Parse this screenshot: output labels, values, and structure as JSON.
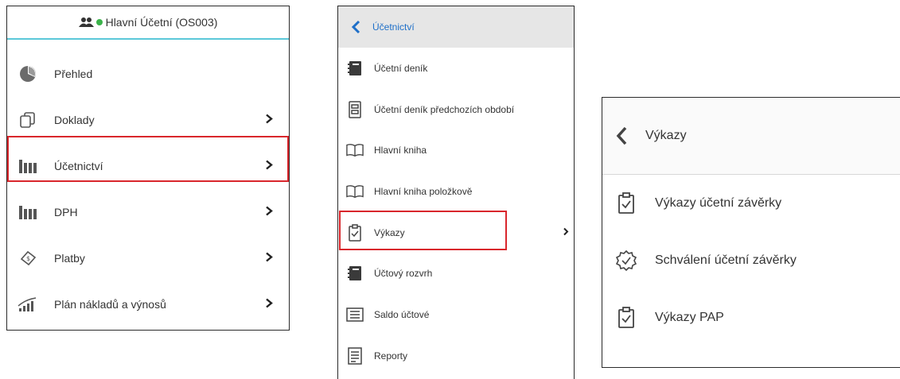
{
  "left_menu": {
    "user_label": "Hlavní Účetní (OS003)",
    "items": [
      {
        "label": "Přehled"
      },
      {
        "label": "Doklady"
      },
      {
        "label": "Účetnictví"
      },
      {
        "label": "DPH"
      },
      {
        "label": "Platby"
      },
      {
        "label": "Plán nákladů a výnosů"
      }
    ]
  },
  "accounting_menu": {
    "title": "Účetnictví",
    "items": [
      {
        "label": "Účetní deník"
      },
      {
        "label": "Účetní deník předchozích období"
      },
      {
        "label": "Hlavní kniha"
      },
      {
        "label": "Hlavní kniha položkově"
      },
      {
        "label": "Výkazy"
      },
      {
        "label": "Účtový rozvrh"
      },
      {
        "label": "Saldo účtové"
      },
      {
        "label": "Reporty"
      }
    ]
  },
  "reports_menu": {
    "title": "Výkazy",
    "items": [
      {
        "label": "Výkazy účetní závěrky"
      },
      {
        "label": "Schválení účetní závěrky"
      },
      {
        "label": "Výkazy PAP"
      }
    ]
  },
  "colors": {
    "accent_blue": "#1e6fc8",
    "highlight_red": "#d9262c",
    "online_green": "#3bb34a",
    "divider_teal": "#5bc8d9"
  }
}
